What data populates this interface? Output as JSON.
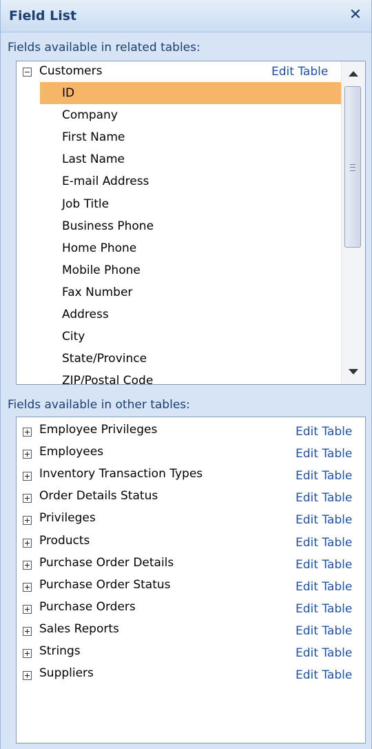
{
  "pane": {
    "title": "Field List",
    "close_glyph": "✕"
  },
  "related": {
    "label": "Fields available in related tables:",
    "table": {
      "name": "Customers",
      "edit_label": "Edit Table",
      "expanded": true
    },
    "fields": [
      "ID",
      "Company",
      "First Name",
      "Last Name",
      "E-mail Address",
      "Job Title",
      "Business Phone",
      "Home Phone",
      "Mobile Phone",
      "Fax Number",
      "Address",
      "City",
      "State/Province",
      "ZIP/Postal Code"
    ],
    "selected_field": "ID"
  },
  "other": {
    "label": "Fields available in other tables:",
    "edit_label": "Edit Table",
    "tables": [
      "Employee Privileges",
      "Employees",
      "Inventory Transaction Types",
      "Order Details Status",
      "Privileges",
      "Products",
      "Purchase Order Details",
      "Purchase Order Status",
      "Purchase Orders",
      "Sales Reports",
      "Strings",
      "Suppliers"
    ]
  },
  "colors": {
    "selection": "#f7b567",
    "link": "#1f4fa8",
    "title": "#1a3f72"
  }
}
